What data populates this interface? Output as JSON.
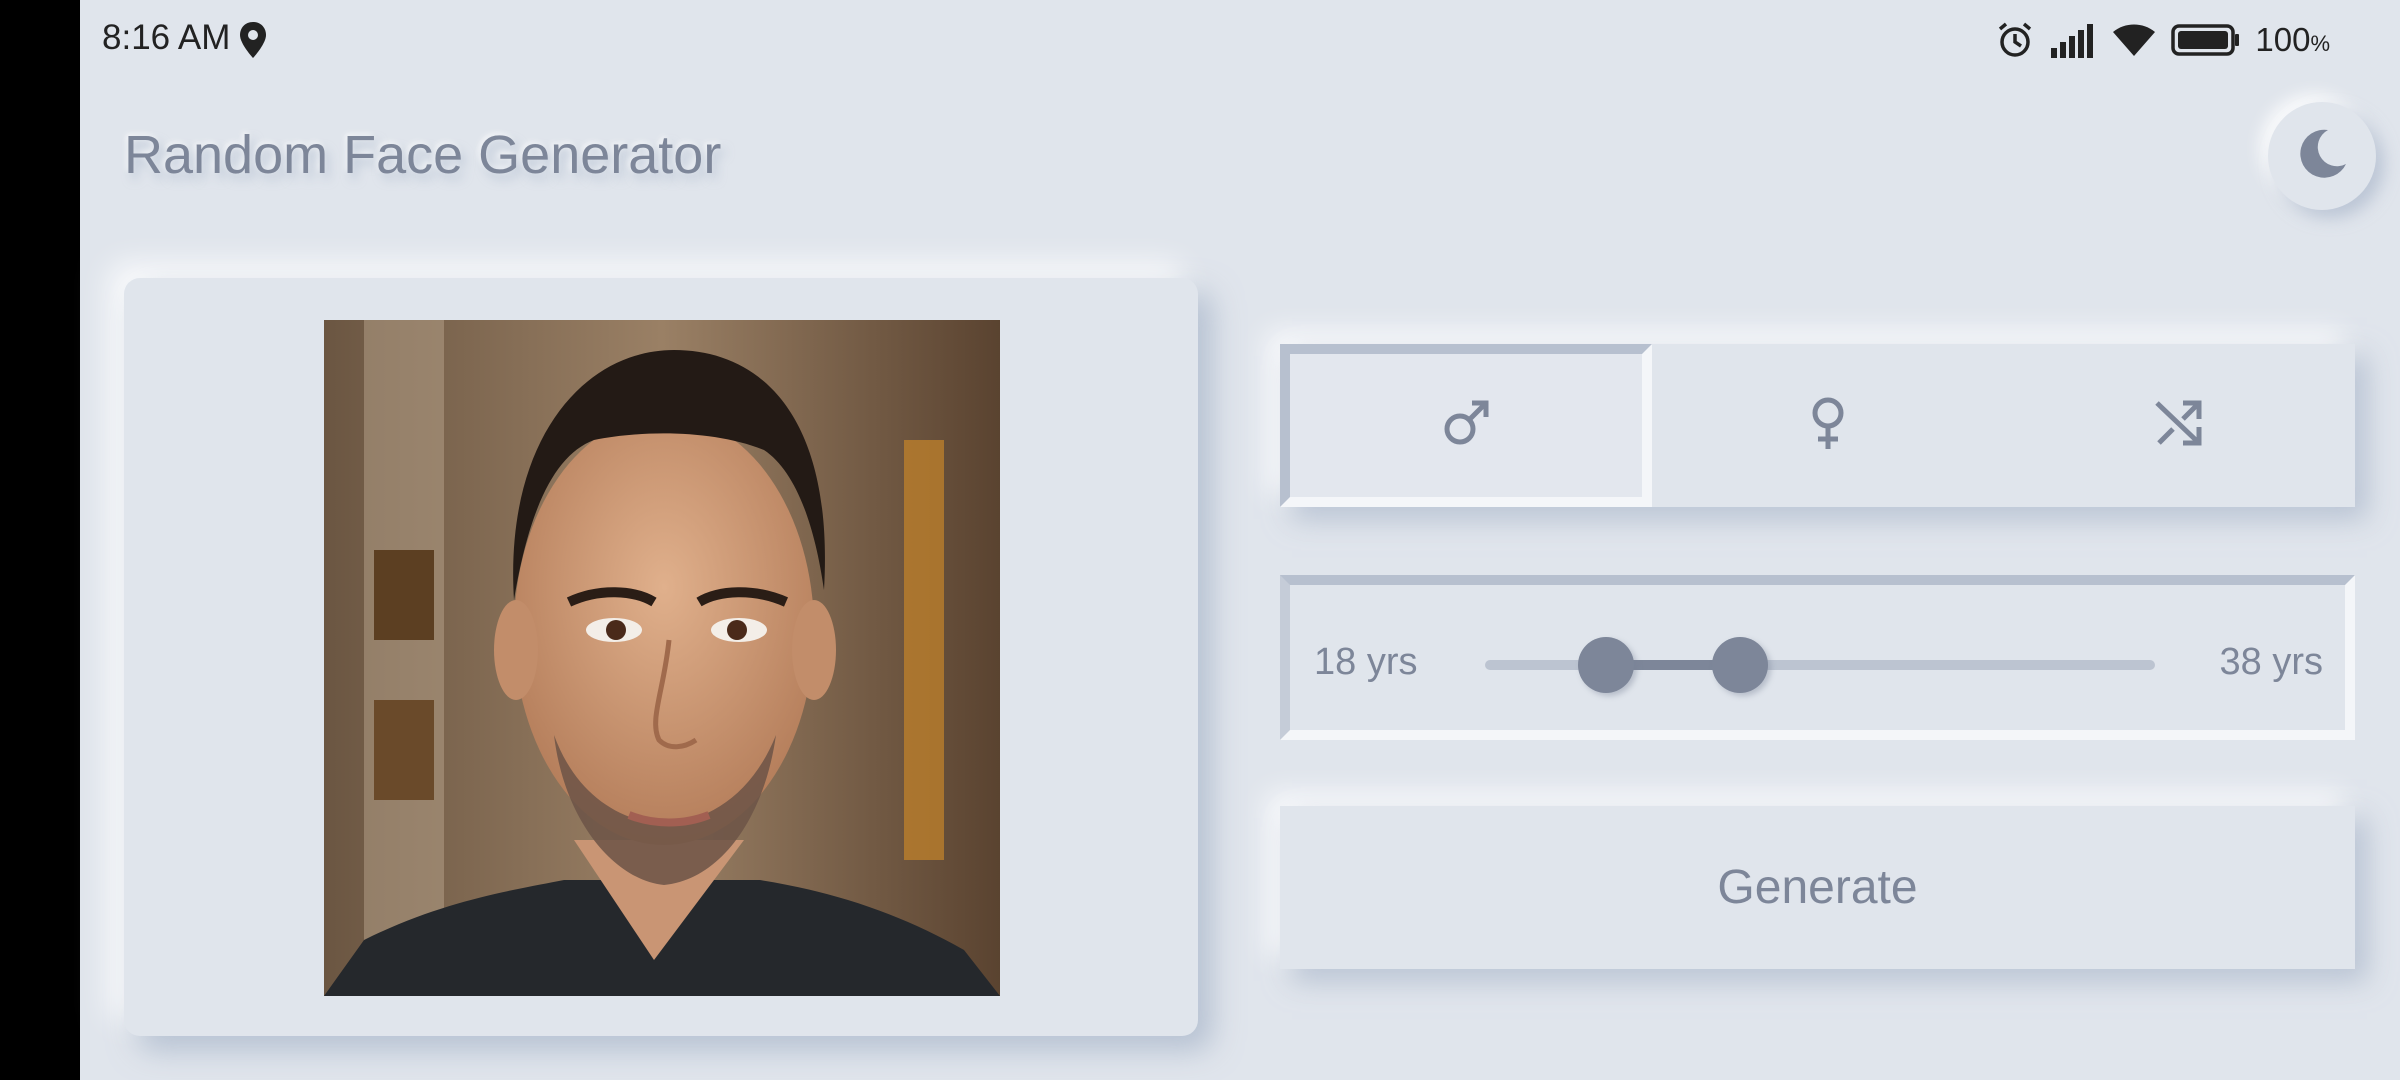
{
  "status_bar": {
    "time": "8:16 AM",
    "battery_percent": "100",
    "battery_unit": "%",
    "icons": [
      "location-icon",
      "alarm-icon",
      "signal-icon",
      "wifi-icon",
      "battery-icon"
    ]
  },
  "header": {
    "title": "Random Face Generator",
    "theme_toggle_icon": "moon-icon"
  },
  "image_card": {
    "content": "generated-face-photo"
  },
  "gender_selector": {
    "options": [
      {
        "icon": "male-icon",
        "selected": true
      },
      {
        "icon": "female-icon",
        "selected": false
      },
      {
        "icon": "shuffle-icon",
        "selected": false
      }
    ]
  },
  "age_range": {
    "min_label": "18 yrs",
    "max_label": "38 yrs",
    "lower_fraction": 0.18,
    "upper_fraction": 0.38
  },
  "generate_button": {
    "label": "Generate"
  },
  "colors": {
    "background": "#e0e5ec",
    "accent": "#7d8699",
    "track": "#bcc4d1"
  }
}
